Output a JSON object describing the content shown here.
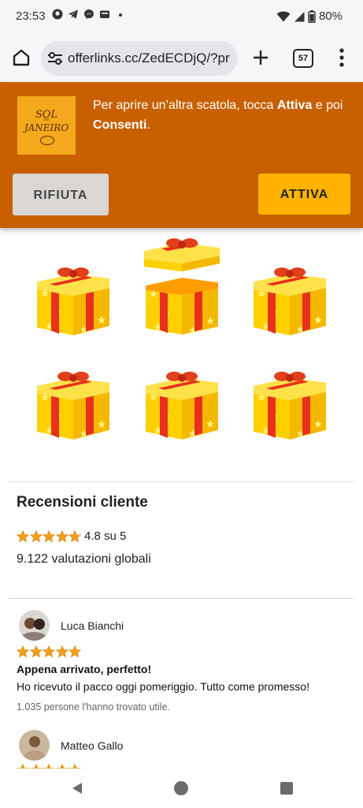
{
  "status_bar": {
    "time": "23:53",
    "battery": "80%",
    "notification_icons": [
      "github-icon",
      "telegram-icon",
      "messenger-icon",
      "mail-icon",
      "dot-icon"
    ]
  },
  "browser": {
    "url": "offerlinks.cc/ZedECDjQ/?pr",
    "tab_count": "57"
  },
  "banner": {
    "logo": {
      "line1": "SOL",
      "line2": "DE",
      "line3": "JANEIRO"
    },
    "msg_part1": "Per aprire un’altra scatola, tocca ",
    "msg_bold1": "Attiva",
    "msg_part2": " e poi ",
    "msg_bold2": "Consenti",
    "msg_part3": ".",
    "reject_label": "RIFIUTA",
    "accept_label": "ATTIVA"
  },
  "gifts": {
    "count": 6,
    "opened_index": 1,
    "colors": {
      "box": "#ffd000",
      "ribbon": "#e8301c",
      "bow": "#e0401a"
    }
  },
  "reviews": {
    "title": "Recensioni cliente",
    "average_stars": 4.8,
    "rating_text": "4.8 su 5",
    "global_count": "9.122 valutazioni globali",
    "star_color": "#f49e1c",
    "items": [
      {
        "name": "Luca Bianchi",
        "stars": 5,
        "headline": "Appena arrivato, perfetto!",
        "body": "Ho ricevuto il pacco oggi pomeriggio. Tutto come promesso!",
        "helpful": "1.035 persone l'hanno trovato utile."
      },
      {
        "name": "Matteo Gallo",
        "stars": 5
      }
    ]
  },
  "colors": {
    "banner_bg": "#c86000",
    "accept_button": "#ffb300",
    "reject_button": "#d9d6d3"
  }
}
